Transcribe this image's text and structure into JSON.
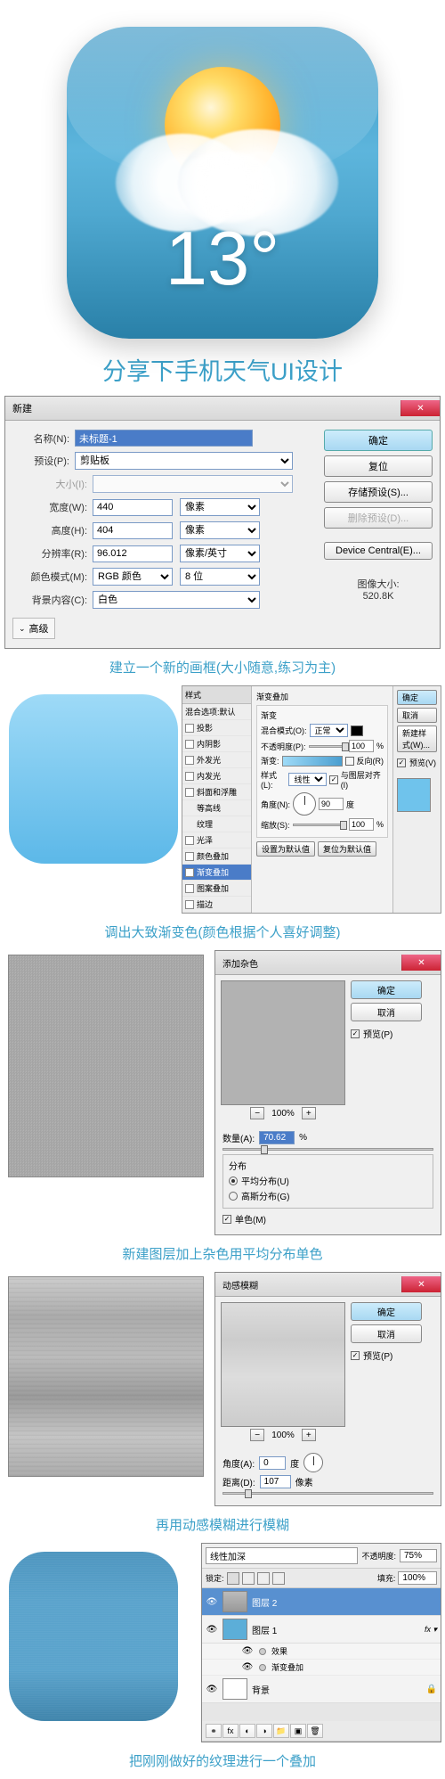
{
  "icon": {
    "temp": "13°"
  },
  "titles": {
    "main": "分享下手机天气UI设计",
    "cap1": "建立一个新的画框(大小随意,练习为主)",
    "cap2": "调出大致渐变色(颜色根据个人喜好调整)",
    "cap3": "新建图层加上杂色用平均分布单色",
    "cap4": "再用动感模糊进行模糊",
    "cap5": "把刚刚做好的纹理进行一个叠加"
  },
  "newDialog": {
    "title": "新建",
    "name_lbl": "名称(N):",
    "name_val": "未标题-1",
    "preset_lbl": "预设(P):",
    "preset_val": "剪贴板",
    "size_lbl": "大小(I):",
    "width_lbl": "宽度(W):",
    "width_val": "440",
    "width_unit": "像素",
    "height_lbl": "高度(H):",
    "height_val": "404",
    "height_unit": "像素",
    "res_lbl": "分辨率(R):",
    "res_val": "96.012",
    "res_unit": "像素/英寸",
    "mode_lbl": "颜色模式(M):",
    "mode_val": "RGB 颜色",
    "depth_val": "8 位",
    "bg_lbl": "背景内容(C):",
    "bg_val": "白色",
    "ok": "确定",
    "reset": "复位",
    "save": "存储预设(S)...",
    "delete": "删除预设(D)...",
    "device": "Device Central(E)...",
    "size_info_lbl": "图像大小:",
    "size_info": "520.8K",
    "advanced": "高级"
  },
  "layerStyle": {
    "title": "样式",
    "gradTitle": "渐变叠加",
    "sect": "渐变",
    "items": [
      "混合选项:默认",
      "投影",
      "内阴影",
      "外发光",
      "内发光",
      "斜面和浮雕",
      "等高线",
      "纹理",
      "光泽",
      "颜色叠加",
      "渐变叠加",
      "图案叠加",
      "描边"
    ],
    "blend_lbl": "混合模式(O):",
    "blend_val": "正常",
    "opacity_lbl": "不透明度(P):",
    "opacity_val": "100",
    "pct": "%",
    "grad_lbl": "渐变:",
    "reverse": "反向(R)",
    "style_lbl": "样式(L):",
    "style_val": "线性",
    "align": "与图层对齐(I)",
    "angle_lbl": "角度(N):",
    "angle_val": "90",
    "deg": "度",
    "scale_lbl": "缩放(S):",
    "scale_val": "100",
    "default1": "设置为默认值",
    "default2": "复位为默认值",
    "ok": "确定",
    "cancel": "取消",
    "newstyle": "新建样式(W)...",
    "preview": "预览(V)"
  },
  "noise": {
    "title": "添加杂色",
    "ok": "确定",
    "cancel": "取消",
    "preview": "预览(P)",
    "zoom": "100%",
    "amount_lbl": "数量(A):",
    "amount_val": "70.62",
    "pct": "%",
    "dist": "分布",
    "uniform": "平均分布(U)",
    "gaussian": "高斯分布(G)",
    "mono": "单色(M)"
  },
  "motion": {
    "title": "动感模糊",
    "ok": "确定",
    "cancel": "取消",
    "preview": "预览(P)",
    "zoom": "100%",
    "angle_lbl": "角度(A):",
    "angle_val": "0",
    "deg": "度",
    "dist_lbl": "距离(D):",
    "dist_val": "107",
    "px": "像素"
  },
  "layers": {
    "mode": "线性加深",
    "opacity_lbl": "不透明度:",
    "opacity": "75%",
    "lock": "锁定:",
    "fill_lbl": "填充:",
    "fill": "100%",
    "l1": "图层 2",
    "l2": "图层 1",
    "fx": "效果",
    "grad": "渐变叠加",
    "bg": "背景"
  }
}
